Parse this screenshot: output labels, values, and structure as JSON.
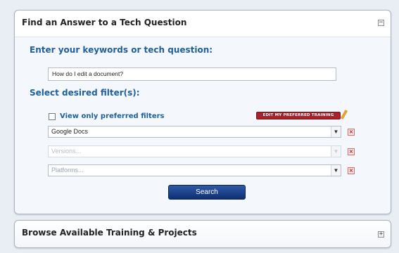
{
  "find_panel": {
    "title": "Find an Answer to a Tech Question",
    "toggle": "−",
    "keywords_label": "Enter your keywords or tech question:",
    "keywords_value": "How do I edit a document?",
    "filters_label": "Select desired filter(s):",
    "preferred_filters_label": "View only preferred filters",
    "preferred_filters_checked": false,
    "edit_preferred_label": "EDIT MY PREFERRED TRAINING",
    "filters": [
      {
        "value": "Google Docs",
        "state": "selected"
      },
      {
        "value": "Versions...",
        "state": "disabled"
      },
      {
        "value": "Platforms...",
        "state": "placeholder"
      }
    ],
    "search_label": "Search"
  },
  "browse_panel": {
    "title": "Browse Available Training & Projects",
    "toggle": "+"
  },
  "colors": {
    "accent_blue": "#1f5f9e",
    "button_navy": "#0f2f72",
    "edit_red": "#a6232a",
    "remove_red": "#c02020"
  },
  "icons": {
    "dropdown": "chevron-down-icon",
    "remove": "remove-x-icon",
    "edit": "pencil-icon"
  }
}
